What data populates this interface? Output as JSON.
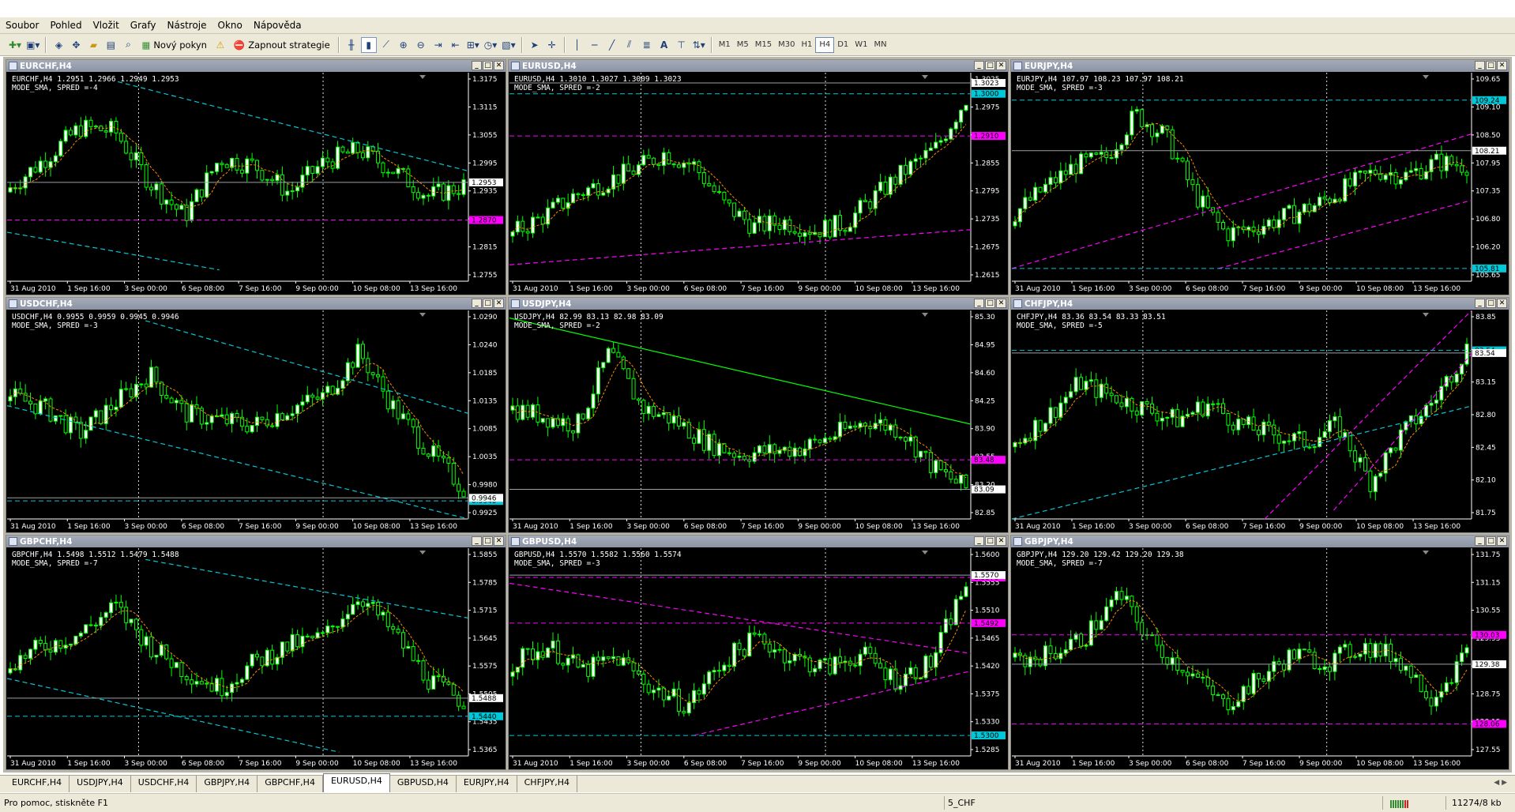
{
  "menu": [
    "Soubor",
    "Pohled",
    "Vložit",
    "Grafy",
    "Nástroje",
    "Okno",
    "Nápověda"
  ],
  "toolbar": {
    "new_order": "Nový pokyn",
    "autotrading": "Zapnout strategie",
    "timeframes": [
      "M1",
      "M5",
      "M15",
      "M30",
      "H1",
      "H4",
      "D1",
      "W1",
      "MN"
    ],
    "active_timeframe": "H4"
  },
  "x_labels": [
    "31 Aug 2010",
    "1 Sep 16:00",
    "3 Sep 00:00",
    "6 Sep 08:00",
    "7 Sep 16:00",
    "9 Sep 00:00",
    "10 Sep 08:00",
    "13 Sep 16:00"
  ],
  "charts": [
    {
      "title": "EURCHF,H4",
      "info1": "EURCHF,H4  1.2951 1.2966 1.2949 1.2953",
      "info2": "MODE_SMA, SPRED =-4",
      "y_labels": [
        "1.3175",
        "1.3115",
        "1.3055",
        "1.2995",
        "1.2935",
        "1.2875",
        "1.2815",
        "1.2755"
      ],
      "y_min": 1.2735,
      "y_max": 1.3195,
      "price": 1.2953,
      "price_label": "1.2953",
      "hlines": [
        {
          "v": 1.287,
          "color": "#ff00ff",
          "label": "1.2870"
        }
      ],
      "tlines": [
        {
          "x1": 0.24,
          "v1": 1.3175,
          "x2": 1.0,
          "v2": 1.2978,
          "color": "#00c8d8"
        },
        {
          "x1": 0.0,
          "v1": 1.2843,
          "x2": 0.46,
          "v2": 1.276,
          "color": "#00c8d8"
        }
      ],
      "path": [
        0.45,
        0.62,
        0.8,
        0.78,
        0.48,
        0.28,
        0.62,
        0.58,
        0.42,
        0.6,
        0.67,
        0.55,
        0.4,
        0.46
      ]
    },
    {
      "title": "EURUSD,H4",
      "info1": "EURUSD,H4  1.3010 1.3027 1.3009 1.3023",
      "info2": "MODE_SMA, SPRED =-2",
      "y_labels": [
        "1.3025",
        "1.2975",
        "1.2915",
        "1.2855",
        "1.2795",
        "1.2735",
        "1.2675",
        "1.2615"
      ],
      "y_min": 1.26,
      "y_max": 1.3045,
      "price": 1.3023,
      "price_label": "1.3023",
      "hlines": [
        {
          "v": 1.3,
          "color": "#00c8d8",
          "label": "1.3000"
        },
        {
          "v": 1.291,
          "color": "#ff00ff",
          "label": "1.2910"
        }
      ],
      "tlines": [
        {
          "x1": 0.0,
          "v1": 1.2635,
          "x2": 1.0,
          "v2": 1.271,
          "color": "#ff00ff"
        }
      ],
      "path": [
        0.18,
        0.28,
        0.4,
        0.48,
        0.55,
        0.65,
        0.58,
        0.35,
        0.22,
        0.25,
        0.2,
        0.24,
        0.4,
        0.55,
        0.68,
        0.97
      ]
    },
    {
      "title": "EURJPY,H4",
      "info1": "EURJPY,H4  107.97 108.23 107.97 108.21",
      "info2": "MODE_SMA, SPRED =-3",
      "y_labels": [
        "109.65",
        "109.10",
        "108.50",
        "107.95",
        "107.35",
        "106.80",
        "106.20",
        "105.65"
      ],
      "y_min": 105.55,
      "y_max": 109.8,
      "price": 108.21,
      "price_label": "108.21",
      "hlines": [
        {
          "v": 109.24,
          "color": "#00c8d8",
          "label": "109.24"
        },
        {
          "v": 105.81,
          "color": "#00c8d8",
          "label": "105.81"
        }
      ],
      "tlines": [
        {
          "x1": 0.0,
          "v1": 105.81,
          "x2": 1.0,
          "v2": 108.55,
          "color": "#ff00ff"
        },
        {
          "x1": 0.45,
          "v1": 105.81,
          "x2": 1.0,
          "v2": 107.2,
          "color": "#ff00ff"
        }
      ],
      "path": [
        0.3,
        0.45,
        0.58,
        0.62,
        0.88,
        0.75,
        0.4,
        0.18,
        0.22,
        0.28,
        0.35,
        0.45,
        0.55,
        0.52,
        0.6,
        0.58
      ]
    },
    {
      "title": "USDCHF,H4",
      "info1": "USDCHF,H4  0.9955 0.9959 0.9945 0.9946",
      "info2": "MODE_SMA, SPRED =-3",
      "y_labels": [
        "1.0290",
        "1.0240",
        "1.0185",
        "1.0135",
        "1.0085",
        "1.0035",
        "0.9980",
        "0.9925"
      ],
      "y_min": 0.9905,
      "y_max": 1.031,
      "price": 0.9946,
      "price_label": "0.9946",
      "hlines": [
        {
          "v": 0.994,
          "color": "#00c8d8",
          "label": "0.9940"
        }
      ],
      "tlines": [
        {
          "x1": 0.3,
          "v1": 1.029,
          "x2": 1.0,
          "v2": 1.011,
          "color": "#00c8d8"
        },
        {
          "x1": 0.0,
          "v1": 1.0125,
          "x2": 1.0,
          "v2": 0.9905,
          "color": "#00c8d8"
        }
      ],
      "path": [
        0.62,
        0.55,
        0.4,
        0.58,
        0.75,
        0.52,
        0.48,
        0.45,
        0.55,
        0.62,
        0.88,
        0.55,
        0.3,
        0.08
      ]
    },
    {
      "title": "USDJPY,H4",
      "info1": "USDJPY,H4  82.99 83.13 82.98 83.09",
      "info2": "MODE_SMA, SPRED =-2",
      "y_labels": [
        "85.30",
        "84.95",
        "84.60",
        "84.25",
        "83.90",
        "83.55",
        "83.20",
        "82.85"
      ],
      "y_min": 82.7,
      "y_max": 85.45,
      "price": 83.09,
      "price_label": "83.09",
      "hlines": [
        {
          "v": 83.48,
          "color": "#ff00ff",
          "label": "83.48"
        }
      ],
      "tlines": [
        {
          "x1": 0.0,
          "v1": 85.35,
          "x2": 1.0,
          "v2": 83.95,
          "color": "#00ff00"
        }
      ],
      "path": [
        0.55,
        0.5,
        0.45,
        0.88,
        0.55,
        0.48,
        0.35,
        0.28,
        0.3,
        0.32,
        0.4,
        0.48,
        0.42,
        0.2,
        0.08
      ]
    },
    {
      "title": "CHFJPY,H4",
      "info1": "CHFJPY,H4  83.36 83.54 83.33 83.51",
      "info2": "MODE_SMA, SPRED =-5",
      "y_labels": [
        "83.85",
        "83.50",
        "83.15",
        "82.80",
        "82.45",
        "82.10",
        "81.75"
      ],
      "y_min": 81.6,
      "y_max": 84.0,
      "price": 83.51,
      "price_label": "83.54",
      "hlines": [
        {
          "v": 83.54,
          "color": "#00c8d8",
          "label": "83.54"
        }
      ],
      "tlines": [
        {
          "x1": 0.0,
          "v1": 81.6,
          "x2": 1.0,
          "v2": 82.9,
          "color": "#00c8d8"
        },
        {
          "x1": 0.55,
          "v1": 81.6,
          "x2": 1.0,
          "v2": 84.0,
          "color": "#ff00ff"
        },
        {
          "x1": 0.7,
          "v1": 81.7,
          "x2": 1.0,
          "v2": 83.5,
          "color": "#ff00ff"
        }
      ],
      "path": [
        0.35,
        0.5,
        0.7,
        0.62,
        0.55,
        0.48,
        0.58,
        0.45,
        0.4,
        0.35,
        0.45,
        0.12,
        0.4,
        0.6,
        0.9
      ]
    },
    {
      "title": "GBPCHF,H4",
      "info1": "GBPCHF,H4  1.5498 1.5512 1.5479 1.5488",
      "info2": "MODE_SMA, SPRED =-7",
      "y_labels": [
        "1.5855",
        "1.5785",
        "1.5715",
        "1.5645",
        "1.5575",
        "1.5505",
        "1.5435",
        "1.5365"
      ],
      "y_min": 1.5335,
      "y_max": 1.5885,
      "price": 1.5488,
      "price_label": "1.5488",
      "hlines": [
        {
          "v": 1.544,
          "color": "#00c8d8",
          "label": "1.5440"
        }
      ],
      "tlines": [
        {
          "x1": 0.3,
          "v1": 1.5855,
          "x2": 1.0,
          "v2": 1.57,
          "color": "#00c8d8"
        },
        {
          "x1": 0.0,
          "v1": 1.554,
          "x2": 0.72,
          "v2": 1.5345,
          "color": "#00c8d8"
        }
      ],
      "path": [
        0.45,
        0.55,
        0.62,
        0.78,
        0.55,
        0.4,
        0.3,
        0.45,
        0.55,
        0.6,
        0.85,
        0.62,
        0.35,
        0.22
      ]
    },
    {
      "title": "GBPUSD,H4",
      "info1": "GBPUSD,H4  1.5570 1.5582 1.5560 1.5574",
      "info2": "MODE_SMA, SPRED =-3",
      "y_labels": [
        "1.5600",
        "1.5555",
        "1.5510",
        "1.5465",
        "1.5420",
        "1.5375",
        "1.5330",
        "1.5285"
      ],
      "y_min": 1.5265,
      "y_max": 1.562,
      "price": 1.5574,
      "price_label": "1.5570",
      "hlines": [
        {
          "v": 1.557,
          "color": "#ff00ff",
          "label": "1.5570"
        },
        {
          "v": 1.5492,
          "color": "#ff00ff",
          "label": "1.5492"
        },
        {
          "v": 1.53,
          "color": "#00c8d8",
          "label": "1.5300"
        }
      ],
      "tlines": [
        {
          "x1": 0.0,
          "v1": 1.556,
          "x2": 1.0,
          "v2": 1.544,
          "color": "#ff00ff"
        },
        {
          "x1": 0.4,
          "v1": 1.53,
          "x2": 1.0,
          "v2": 1.541,
          "color": "#ff00ff"
        }
      ],
      "path": [
        0.45,
        0.55,
        0.4,
        0.48,
        0.3,
        0.2,
        0.45,
        0.6,
        0.48,
        0.42,
        0.5,
        0.35,
        0.45,
        0.92
      ]
    },
    {
      "title": "GBPJPY,H4",
      "info1": "GBPJPY,H4  129.20 129.42 129.20 129.38",
      "info2": "MODE_SMA, SPRED =-7",
      "y_labels": [
        "131.75",
        "131.15",
        "130.55",
        "129.95",
        "129.35",
        "128.75",
        "128.15",
        "127.55"
      ],
      "y_min": 127.35,
      "y_max": 131.95,
      "price": 129.38,
      "price_label": "129.38",
      "hlines": [
        {
          "v": 130.03,
          "color": "#ff00ff",
          "label": "130.03"
        },
        {
          "v": 128.06,
          "color": "#ff00ff",
          "label": "128.06"
        }
      ],
      "tlines": [],
      "path": [
        0.45,
        0.5,
        0.6,
        0.85,
        0.55,
        0.4,
        0.2,
        0.35,
        0.5,
        0.45,
        0.55,
        0.48,
        0.25,
        0.5
      ]
    }
  ],
  "tabs": [
    "EURCHF,H4",
    "USDJPY,H4",
    "USDCHF,H4",
    "GBPJPY,H4",
    "GBPCHF,H4",
    "EURUSD,H4",
    "GBPUSD,H4",
    "EURJPY,H4",
    "CHFJPY,H4"
  ],
  "active_tab": "EURUSD,H4",
  "status": {
    "help": "Pro pomoc, stiskněte F1",
    "profile": "5_CHF",
    "traffic": "11274/8 kb"
  },
  "colors": {
    "bg": "#000000",
    "candle": "#00ff00",
    "bull_body": "#ffffff",
    "ma": "#ff8c00",
    "grid": "#ffffff"
  }
}
